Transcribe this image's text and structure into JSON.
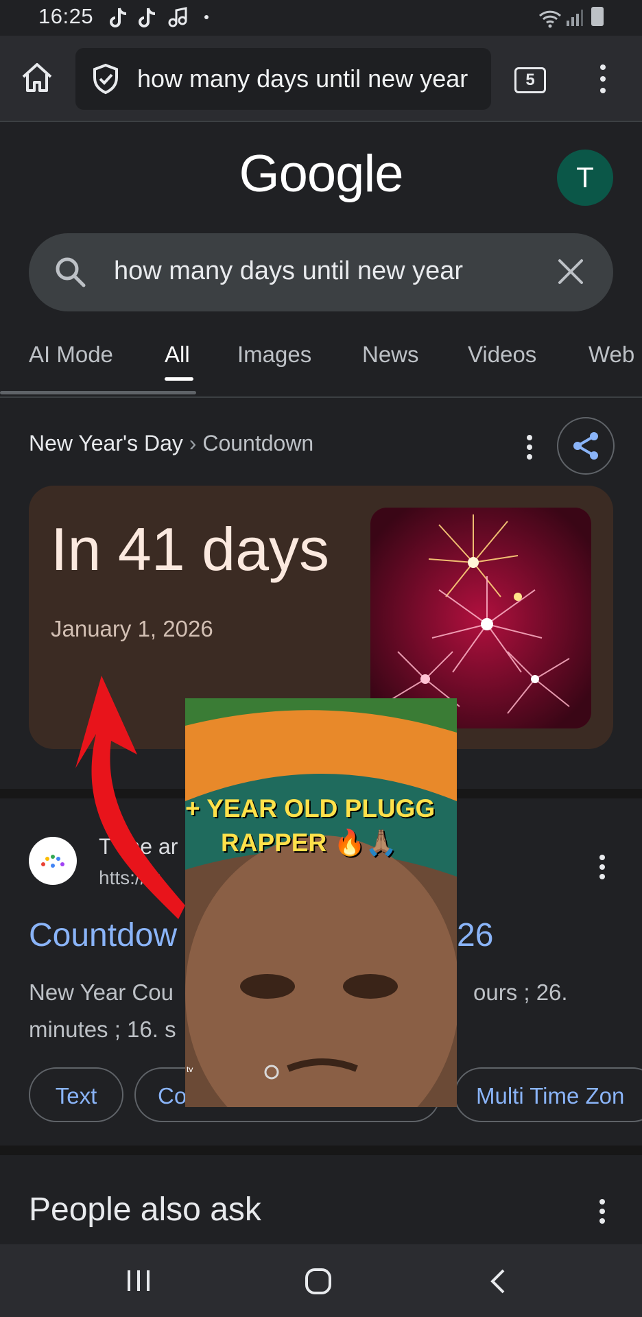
{
  "status_bar": {
    "time": "16:25",
    "app_icons": [
      "tiktok-icon",
      "tiktok-icon",
      "music-icon"
    ],
    "system_icons": [
      "wifi-icon",
      "signal-icon",
      "battery-icon"
    ]
  },
  "browser": {
    "url_text": "how many days until new year",
    "tab_count": "5"
  },
  "google": {
    "logo": "Google",
    "avatar_letter": "T"
  },
  "search": {
    "query": "how many days until new year"
  },
  "tabs": [
    {
      "label": "AI Mode"
    },
    {
      "label": "All",
      "active": true
    },
    {
      "label": "Images"
    },
    {
      "label": "News"
    },
    {
      "label": "Videos"
    },
    {
      "label": "Web"
    }
  ],
  "countdown": {
    "breadcrumb_a": "New Year's Day",
    "breadcrumb_sep": " › ",
    "breadcrumb_b": "Countdown",
    "headline": "In 41 days",
    "date": "January 1, 2026"
  },
  "result": {
    "site_name": "T",
    "site_name_b": "me ar",
    "site_url": "htt",
    "site_url_b": "s://w",
    "title_start": "Countdow",
    "title_end": "26",
    "snippet1_start": "New Year Cou",
    "snippet1_end": "ours ; 26.",
    "snippet2": "minutes ; 16. s"
  },
  "chips": [
    {
      "label": "Text"
    },
    {
      "label": "Co"
    },
    {
      "label": "Multi Time Zon"
    }
  ],
  "people_also_ask": {
    "title": "People also ask"
  },
  "overlay": {
    "line1": "+ YEAR OLD PLUGG",
    "line2": "RAPPER 🔥🙏🏽",
    "small": "tv"
  },
  "colors": {
    "background": "#202124",
    "link": "#8ab4f8",
    "card": "#3b2b23",
    "overlay_text": "#ffe14a"
  }
}
